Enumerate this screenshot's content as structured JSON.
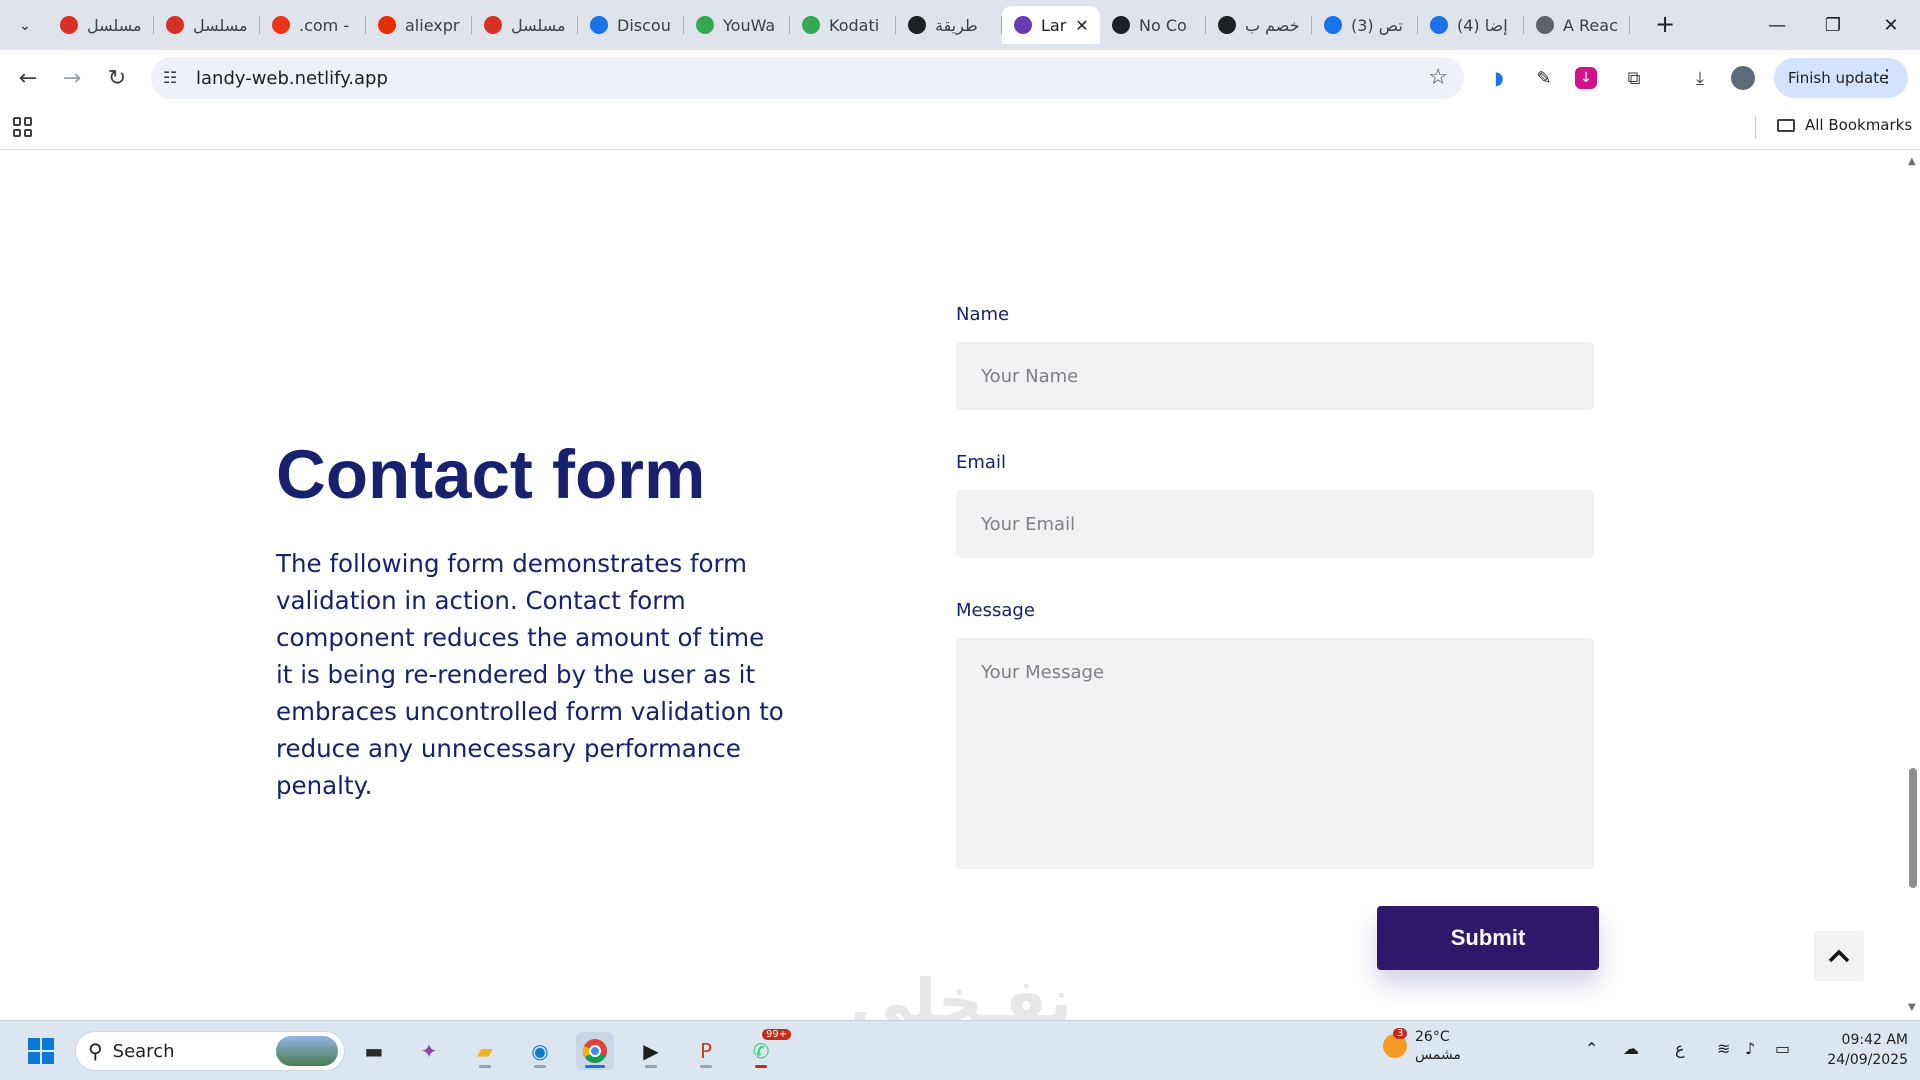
{
  "browser": {
    "tabs": [
      {
        "title": "مسلسل",
        "favicon": "red-swirl-icon",
        "color": "#d93025"
      },
      {
        "title": "مسلسل",
        "favicon": "red-swirl-icon",
        "color": "#d93025"
      },
      {
        "title": ".com -",
        "favicon": "shop-bag-icon",
        "color": "#e8341c"
      },
      {
        "title": "aliexpr",
        "favicon": "aliexpress-icon",
        "color": "#e62e04"
      },
      {
        "title": "مسلسل",
        "favicon": "red-swirl-icon",
        "color": "#d93025"
      },
      {
        "title": "Discou",
        "favicon": "discount-y-icon",
        "color": "#1a73e8"
      },
      {
        "title": "YouWa",
        "favicon": "gear-green-icon",
        "color": "#34a853"
      },
      {
        "title": "Kodati",
        "favicon": "gear-green-icon",
        "color": "#34a853"
      },
      {
        "title": "طريقة",
        "favicon": "openai-icon",
        "color": "#202124"
      },
      {
        "title": "Lar",
        "favicon": "z-letter-icon",
        "color": "#673ab7",
        "active": true
      },
      {
        "title": "No Co",
        "favicon": "compass-icon",
        "color": "#202124"
      },
      {
        "title": "خصم ب",
        "favicon": "compass-icon",
        "color": "#202124"
      },
      {
        "title": "(3) تص",
        "favicon": "blue-swirl-icon",
        "color": "#1a73e8"
      },
      {
        "title": "(4) إضا",
        "favicon": "blue-swirl-icon",
        "color": "#1a73e8"
      },
      {
        "title": "A Reac",
        "favicon": "globe-icon",
        "color": "#5f6368"
      }
    ],
    "url": "landy-web.netlify.app",
    "finish_update_label": "Finish update",
    "all_bookmarks_label": "All Bookmarks"
  },
  "page": {
    "title": "Contact form",
    "description": "The following form demonstrates form validation in action. Contact form component reduces the amount of time it is being re-rendered by the user as it embraces uncontrolled form validation to reduce any unnecessary performance penalty.",
    "form": {
      "name_label": "Name",
      "name_placeholder": "Your Name",
      "email_label": "Email",
      "email_placeholder": "Your Email",
      "message_label": "Message",
      "message_placeholder": "Your Message",
      "submit_label": "Submit"
    },
    "watermark": "نفـخلي"
  },
  "taskbar": {
    "search_label": "Search",
    "chat_badge": "99+",
    "weather_temp": "26°C",
    "weather_desc": "مشمس",
    "weather_badge": "3",
    "lang": "ع",
    "time": "09:42 AM",
    "date": "24/09/2025"
  },
  "colors": {
    "heading": "#18216d",
    "submit_bg": "#2e186a",
    "field_bg": "#f1f2f3"
  }
}
